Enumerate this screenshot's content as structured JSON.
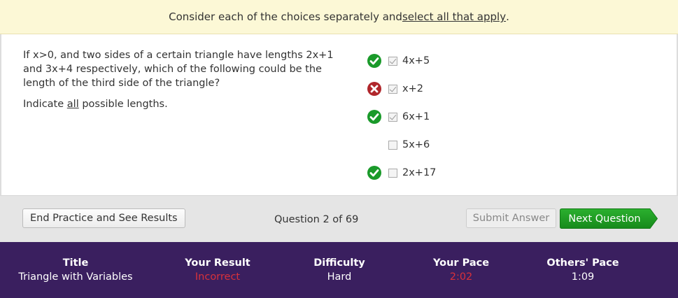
{
  "banner": {
    "text_before": "Consider each of the choices separately and ",
    "text_link": "select all that apply",
    "text_after": "."
  },
  "question": {
    "stem": "If x>0, and two sides of a certain triangle have lengths 2x+1 and 3x+4 respectively, which of the following could be the length of the third side of the triangle?",
    "instruction_before": "Indicate ",
    "instruction_underlined": "all",
    "instruction_after": " possible lengths."
  },
  "choices": [
    {
      "label": "4x+5",
      "checked": true,
      "result": "correct"
    },
    {
      "label": "x+2",
      "checked": true,
      "result": "incorrect"
    },
    {
      "label": "6x+1",
      "checked": true,
      "result": "correct"
    },
    {
      "label": "5x+6",
      "checked": false,
      "result": "none"
    },
    {
      "label": "2x+17",
      "checked": false,
      "result": "correct"
    }
  ],
  "controls": {
    "end_label": "End Practice and See Results",
    "counter": "Question 2 of 69",
    "submit_label": "Submit Answer",
    "next_label": "Next Question"
  },
  "stats": {
    "title_header": "Title",
    "title_value": "Triangle with Variables",
    "result_header": "Your Result",
    "result_value": "Incorrect",
    "difficulty_header": "Difficulty",
    "difficulty_value": "Hard",
    "pace_header": "Your Pace",
    "pace_value": "2:02",
    "others_header": "Others' Pace",
    "others_value": "1:09"
  },
  "colors": {
    "correct": "#1a9a2a",
    "incorrect": "#b0262b",
    "next_button": "#1c9a20",
    "stats_bg": "#3a1f5f",
    "banner_bg": "#fcf8d6"
  }
}
